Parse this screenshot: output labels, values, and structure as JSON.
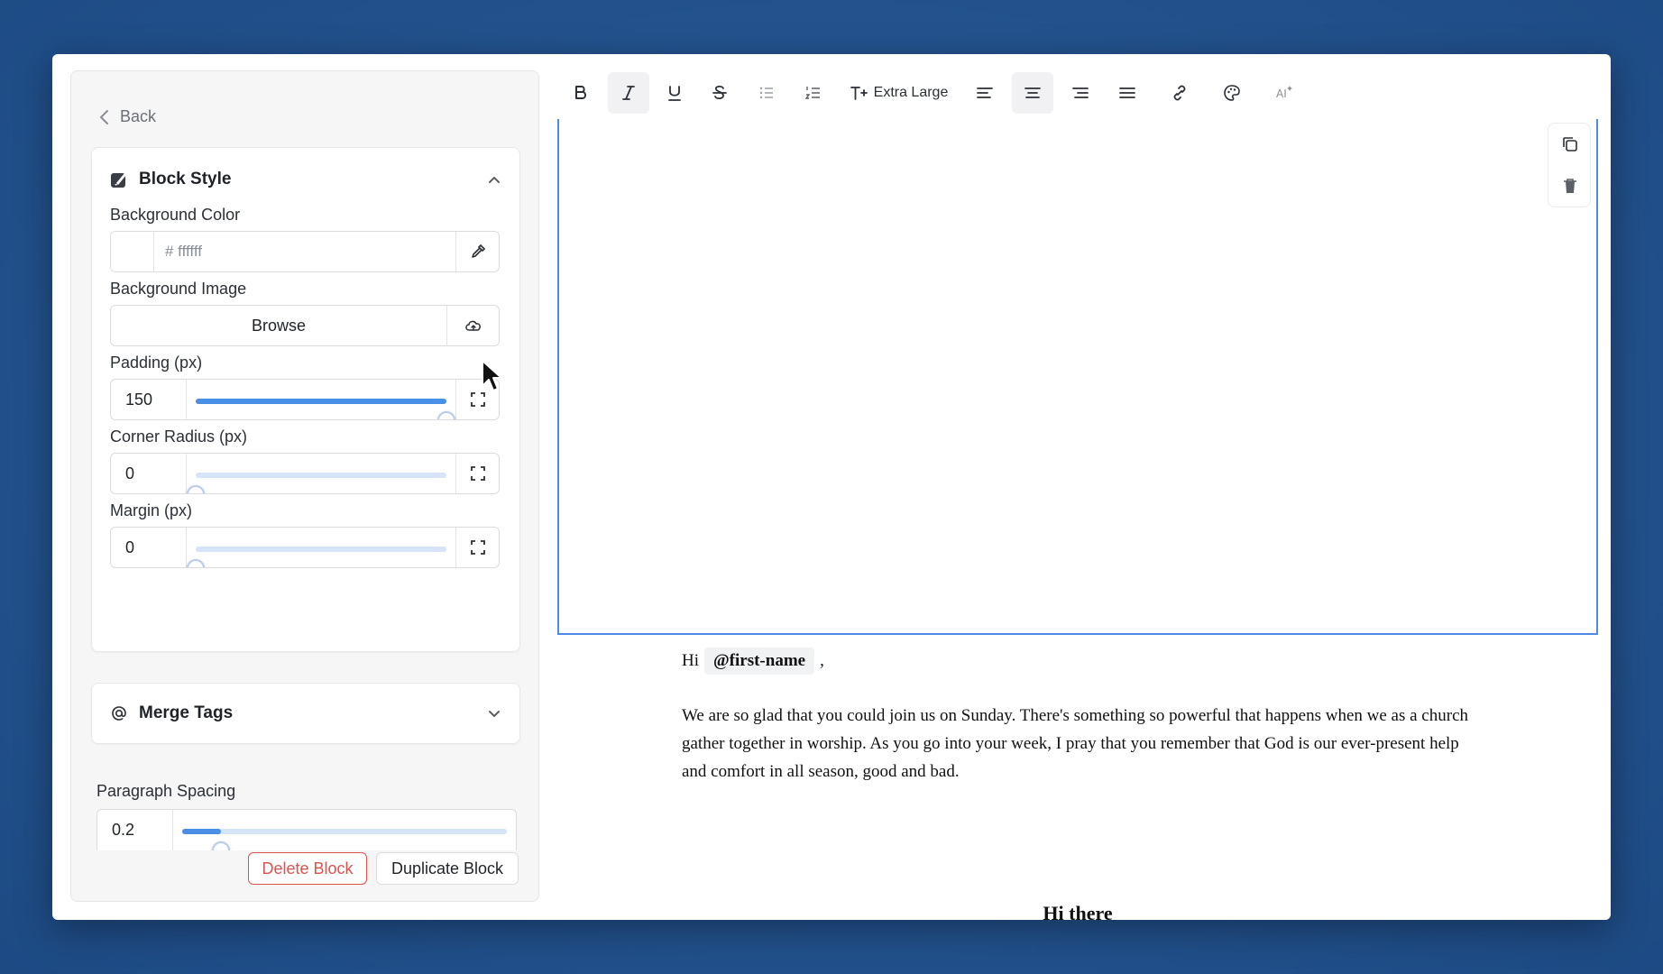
{
  "sidebar": {
    "back_label": "Back",
    "block_style": {
      "title": "Block Style",
      "background_color": {
        "label": "Background Color",
        "value": "# ffffff"
      },
      "background_image": {
        "label": "Background Image",
        "button": "Browse"
      },
      "padding": {
        "label": "Padding (px)",
        "value": "150",
        "fraction": 1.0
      },
      "corner_radius": {
        "label": "Corner Radius (px)",
        "value": "0",
        "fraction": 0.0
      },
      "margin": {
        "label": "Margin (px)",
        "value": "0",
        "fraction": 0.0
      }
    },
    "merge_tags": {
      "title": "Merge Tags"
    },
    "paragraph_spacing": {
      "label": "Paragraph Spacing",
      "value": "0.2",
      "fraction": 0.12
    },
    "delete_label": "Delete Block",
    "duplicate_label": "Duplicate Block"
  },
  "toolbar": {
    "font_size_label": "Extra Large",
    "active": [
      "italic",
      "align-center"
    ]
  },
  "email": {
    "greeting_prefix": "Hi",
    "merge_tag": "@first-name",
    "greeting_suffix": ",",
    "body": "We are so glad that you could join us on Sunday. There's something so powerful that happens when we as a church gather together in worship. As you go into your week, I pray that you remember that God is our ever-present help and comfort in all season, good and bad.",
    "next_heading": "Hi there"
  },
  "colors": {
    "accent": "#4a8fe6",
    "selection_border": "#4f8be4",
    "danger": "#d9534f",
    "background": "#23528d"
  }
}
